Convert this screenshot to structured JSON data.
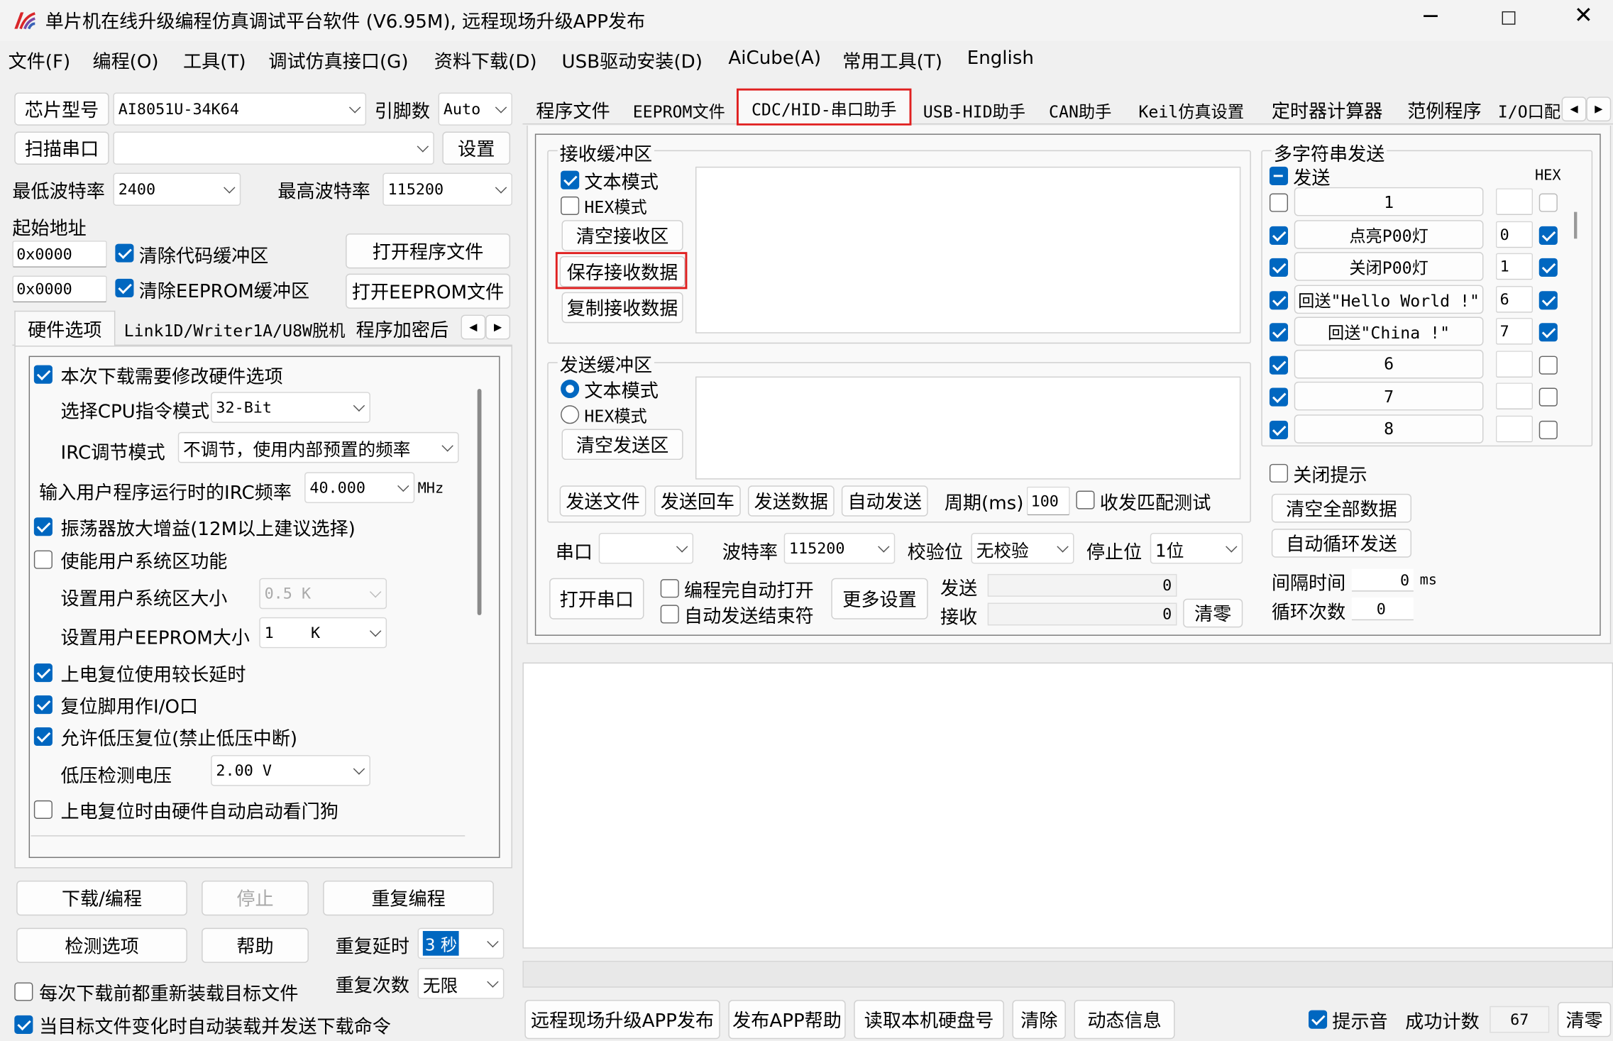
{
  "window": {
    "title": "单片机在线升级编程仿真调试平台软件 (V6.95M), 远程现场升级APP发布"
  },
  "menu": [
    "文件(F)",
    "编程(O)",
    "工具(T)",
    "调试仿真接口(G)",
    "资料下载(D)",
    "USB驱动安装(D)",
    "AiCube(A)",
    "常用工具(T)",
    "English"
  ],
  "left": {
    "chip_label": "芯片型号",
    "chip_value": "AI8051U-34K64",
    "pins_label": "引脚数",
    "pins_value": "Auto",
    "scan_label": "扫描串口",
    "settings_label": "设置",
    "min_baud_label": "最低波特率",
    "min_baud_value": "2400",
    "max_baud_label": "最高波特率",
    "max_baud_value": "115200",
    "start_addr_label": "起始地址",
    "addr1": "0x0000",
    "clear_code_label": "清除代码缓冲区",
    "open_program_label": "打开程序文件",
    "addr2": "0x0000",
    "clear_eeprom_label": "清除EEPROM缓冲区",
    "open_eeprom_label": "打开EEPROM文件",
    "tabs": [
      "硬件选项",
      "Link1D/Writer1A/U8W脱机",
      "程序加密后"
    ],
    "hw": {
      "modify_hw": "本次下载需要修改硬件选项",
      "cpu_mode_label": "选择CPU指令模式",
      "cpu_mode_value": "32-Bit",
      "irc_mode_label": "IRC调节模式",
      "irc_mode_value": "不调节，使用内部预置的频率",
      "irc_freq_label": "输入用户程序运行时的IRC频率",
      "irc_freq_value": "40.000",
      "irc_freq_unit": "MHz",
      "osc_gain": "振荡器放大增益(12M以上建议选择)",
      "user_sys": "使能用户系统区功能",
      "user_sys_size_label": "设置用户系统区大小",
      "user_sys_size_value": "0.5 K",
      "user_eeprom_label": "设置用户EEPROM大小",
      "user_eeprom_value": "1    K",
      "long_delay": "上电复位使用较长延时",
      "reset_io": "复位脚用作I/O口",
      "lvr": "允许低压复位(禁止低压中断)",
      "lvd_label": "低压检测电压",
      "lvd_value": "2.00 V",
      "wdt": "上电复位时由硬件自动启动看门狗"
    },
    "download_label": "下载/编程",
    "stop_label": "停止",
    "reprogram_label": "重复编程",
    "check_label": "检测选项",
    "help_label": "帮助",
    "repeat_delay_label": "重复延时",
    "repeat_delay_value": "3 秒",
    "repeat_count_label": "重复次数",
    "repeat_count_value": "无限",
    "reload_label": "每次下载前都重新装载目标文件",
    "autoload_label": "当目标文件变化时自动装载并发送下载命令"
  },
  "right_tabs": [
    "程序文件",
    "EEPROM文件",
    "CDC/HID-串口助手",
    "USB-HID助手",
    "CAN助手",
    "Keil仿真设置",
    "定时器计算器",
    "范例程序",
    "I/O口配"
  ],
  "serial": {
    "rx_group": "接收缓冲区",
    "rx_text": "文本模式",
    "rx_hex": "HEX模式",
    "rx_clear": "清空接收区",
    "rx_save": "保存接收数据",
    "rx_copy": "复制接收数据",
    "tx_group": "发送缓冲区",
    "tx_text": "文本模式",
    "tx_hex": "HEX模式",
    "tx_clear": "清空发送区",
    "send_file": "发送文件",
    "send_cr": "发送回车",
    "send_data": "发送数据",
    "auto_send": "自动发送",
    "period_label": "周期(ms)",
    "period_value": "100",
    "match_test": "收发匹配测试",
    "port_label": "串口",
    "port_value": "",
    "baud_label": "波特率",
    "baud_value": "115200",
    "parity_label": "校验位",
    "parity_value": "无校验",
    "stop_label": "停止位",
    "stop_value": "1位",
    "open_port": "打开串口",
    "auto_open": "编程完自动打开",
    "auto_close": "自动发送结束符",
    "more_settings": "更多设置",
    "tx_count_label": "发送",
    "tx_count_value": "0",
    "rx_count_label": "接收",
    "rx_count_value": "0",
    "clear_count": "清零"
  },
  "multi": {
    "group": "多字符串发送",
    "send_label": "发送",
    "hex_label": "HEX",
    "rows": [
      {
        "label": "1",
        "idx": "",
        "checked": false,
        "hex": false
      },
      {
        "label": "点亮P00灯",
        "idx": "0",
        "checked": true,
        "hex": true
      },
      {
        "label": "关闭P00灯",
        "idx": "1",
        "checked": true,
        "hex": true
      },
      {
        "label": "回送\"Hello World !\"",
        "idx": "6",
        "checked": true,
        "hex": true
      },
      {
        "label": "回送\"China !\"",
        "idx": "7",
        "checked": true,
        "hex": true
      },
      {
        "label": "6",
        "idx": "",
        "checked": true,
        "hex": false
      },
      {
        "label": "7",
        "idx": "",
        "checked": true,
        "hex": false
      },
      {
        "label": "8",
        "idx": "",
        "checked": true,
        "hex": false
      }
    ],
    "close_hint": "关闭提示",
    "clear_all": "清空全部数据",
    "auto_loop": "自动循环发送",
    "interval_label": "间隔时间",
    "interval_value": "0",
    "interval_unit": "ms",
    "loop_label": "循环次数",
    "loop_value": "0"
  },
  "bottom": {
    "publish": "远程现场升级APP发布",
    "publish_help": "发布APP帮助",
    "read_disk": "读取本机硬盘号",
    "clear": "清除",
    "dynamic": "动态信息",
    "sound": "提示音",
    "success_label": "成功计数",
    "success_value": "67",
    "clear_count": "清零"
  },
  "colors": {
    "accent": "#0067c0",
    "highlight": "#e02020"
  }
}
